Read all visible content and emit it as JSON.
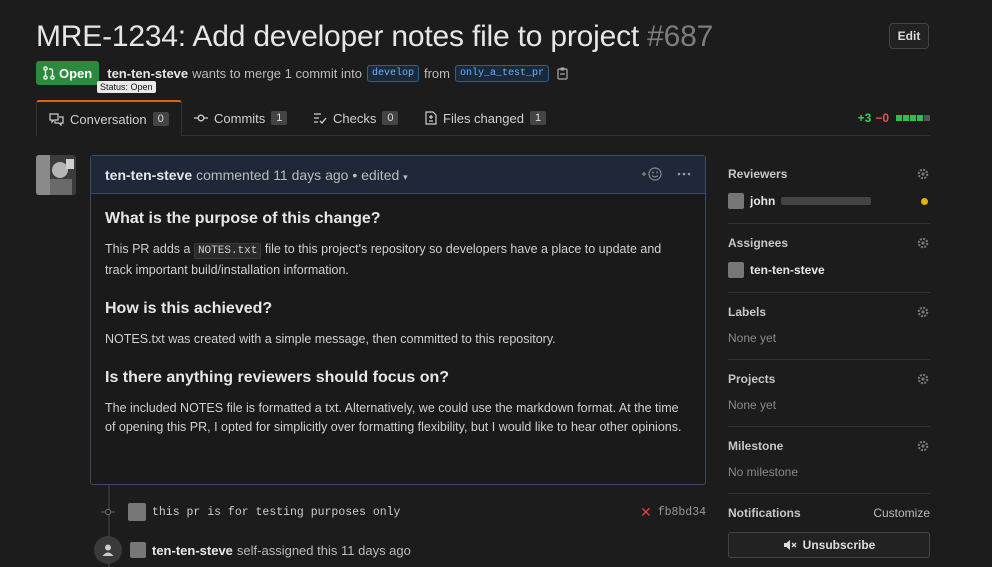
{
  "header": {
    "title": "MRE-1234: Add developer notes file to project",
    "number": "#687",
    "edit_label": "Edit"
  },
  "meta": {
    "state_label": "Open",
    "author": "ten-ten-steve",
    "merge_text": "wants to merge 1 commit into",
    "base_branch": "develop",
    "from_text": "from",
    "head_branch": "only_a_test_pr",
    "tooltip": "Status: Open"
  },
  "tabs": [
    {
      "label": "Conversation",
      "count": "0",
      "icon": "comment-discussion-icon"
    },
    {
      "label": "Commits",
      "count": "1",
      "icon": "git-commit-icon"
    },
    {
      "label": "Checks",
      "count": "0",
      "icon": "checklist-icon"
    },
    {
      "label": "Files changed",
      "count": "1",
      "icon": "file-diff-icon"
    }
  ],
  "diffstat": {
    "additions": "+3",
    "deletions": "−0",
    "blocks": [
      "add",
      "add",
      "add",
      "add",
      "neutral"
    ],
    "colors": {
      "add": "#2cbe4e",
      "del": "#cb2431",
      "neutral": "#555555"
    }
  },
  "comment": {
    "author": "ten-ten-steve",
    "action": "commented",
    "time": "11 days ago",
    "separator": "•",
    "edited": "edited",
    "heading1": "What is the purpose of this change?",
    "para1_before": "This PR adds a",
    "para1_code": "NOTES.txt",
    "para1_after": "file to this project's repository so developers have a place to update and track important build/installation information.",
    "heading2": "How is this achieved?",
    "para2": "NOTES.txt was created with a simple message, then committed to this repository.",
    "heading3": "Is there anything reviewers should focus on?",
    "para3": "The included NOTES file is formatted a txt. Alternatively, we could use the markdown format. At the time of opening this PR, I opted for simplicitly over formatting flexibility, but I would like to hear other opinions."
  },
  "timeline": {
    "commit_message": "this pr is for testing purposes only",
    "commit_sha": "fb8bd34",
    "event_author": "ten-ten-steve",
    "event_action": "self-assigned this",
    "event_time": "11 days ago"
  },
  "sidebar": {
    "reviewers_title": "Reviewers",
    "reviewer_name": "john",
    "assignees_title": "Assignees",
    "assignee_name": "ten-ten-steve",
    "labels_title": "Labels",
    "labels_value": "None yet",
    "projects_title": "Projects",
    "projects_value": "None yet",
    "milestone_title": "Milestone",
    "milestone_value": "No milestone",
    "notifications_title": "Notifications",
    "customize_label": "Customize",
    "unsubscribe_label": "Unsubscribe"
  }
}
